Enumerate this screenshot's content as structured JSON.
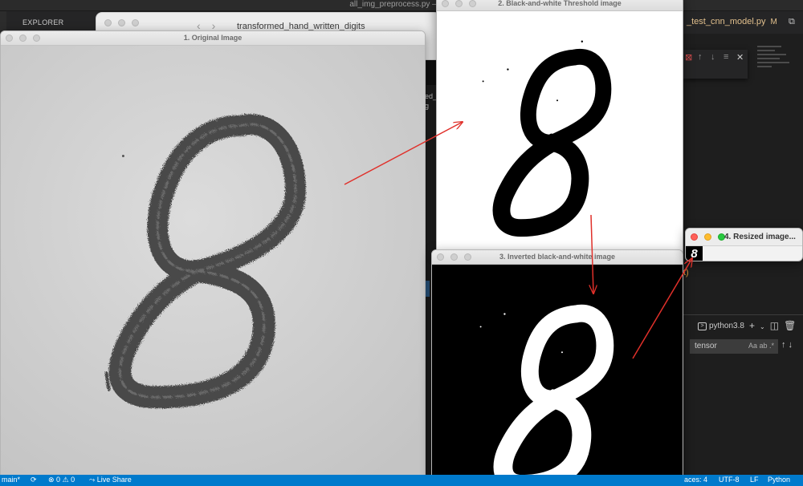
{
  "vscode": {
    "title": "all_img_preprocess.py — Ter",
    "sidebar_title": "EXPLORER",
    "editor_tab": "_test_cnn_model.py",
    "editor_tab_modified": "M",
    "midstrip_text": "ed_\ng",
    "terminal_name": "python3.8",
    "terminal_search_value": "tensor",
    "terminal_search_options": "Aa  ab  .*",
    "code_fragment": "t)",
    "status": {
      "branch": "main*",
      "errors": "0",
      "warnings": "0",
      "live_share": "Live Share",
      "spaces": "aces: 4",
      "encoding": "UTF-8",
      "eol": "LF",
      "language": "Python"
    }
  },
  "finder": {
    "path": "transformed_hand_written_digits"
  },
  "windows": {
    "original": {
      "title": "1. Original Image"
    },
    "threshold": {
      "title": "2. Black-and-white Threshold image"
    },
    "inverted": {
      "title": "3. Inverted black-and-white image"
    },
    "resized": {
      "title": "4. Resized image...",
      "digit": "8"
    }
  },
  "colors": {
    "arrow": "#e0302a",
    "vscode_blue": "#007acc",
    "paper_gray": "#d4d4d4",
    "ink_dark": "#474747"
  }
}
